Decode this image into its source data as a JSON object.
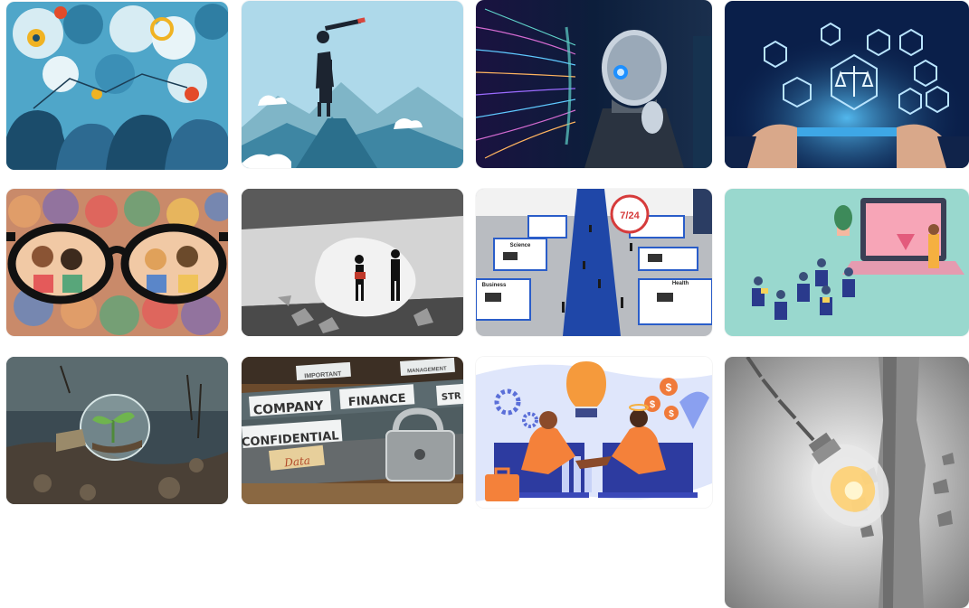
{
  "gallery": {
    "tiles": [
      {
        "id": "people-thinking",
        "alt": "Silhouettes of people with thought bubbles and icons"
      },
      {
        "id": "woman-telescope",
        "alt": "Woman with telescope standing on a mountain peak"
      },
      {
        "id": "robot-thinking",
        "alt": "Humanoid robot thinking with glowing circuits"
      },
      {
        "id": "legal-icons",
        "alt": "Hands holding tablet with justice scale and legal icons"
      },
      {
        "id": "glasses-crowd",
        "alt": "Glasses bringing a blurred crowd into focus"
      },
      {
        "id": "men-breaking-wall",
        "alt": "Two men walking through a broken wall"
      },
      {
        "id": "virtual-expo",
        "alt": "Virtual exhibition hall with booths"
      },
      {
        "id": "online-class",
        "alt": "Audience watching a presenter on a laptop screen"
      },
      {
        "id": "bulb-plant",
        "alt": "Light bulb with a plant growing inside on soil"
      },
      {
        "id": "confidential-folders",
        "alt": "File folders with padlock"
      },
      {
        "id": "handshake-bulb",
        "alt": "Two people shaking hands from laptops under a light bulb"
      },
      {
        "id": "bulb-wall",
        "alt": "Light bulb wrecking ball breaking a concrete wall"
      }
    ]
  },
  "labels": {
    "expo_sign": "7/24",
    "expo_science": "Science",
    "expo_business": "Business",
    "expo_health": "Health",
    "folder_company": "COMPANY",
    "folder_finance": "FINANCE",
    "folder_confidential": "CONFIDENTIAL",
    "folder_data": "Data",
    "folder_important": "IMPORTANT",
    "folder_management": "MANAGEMENT",
    "folder_str": "STR",
    "dollar": "$"
  }
}
